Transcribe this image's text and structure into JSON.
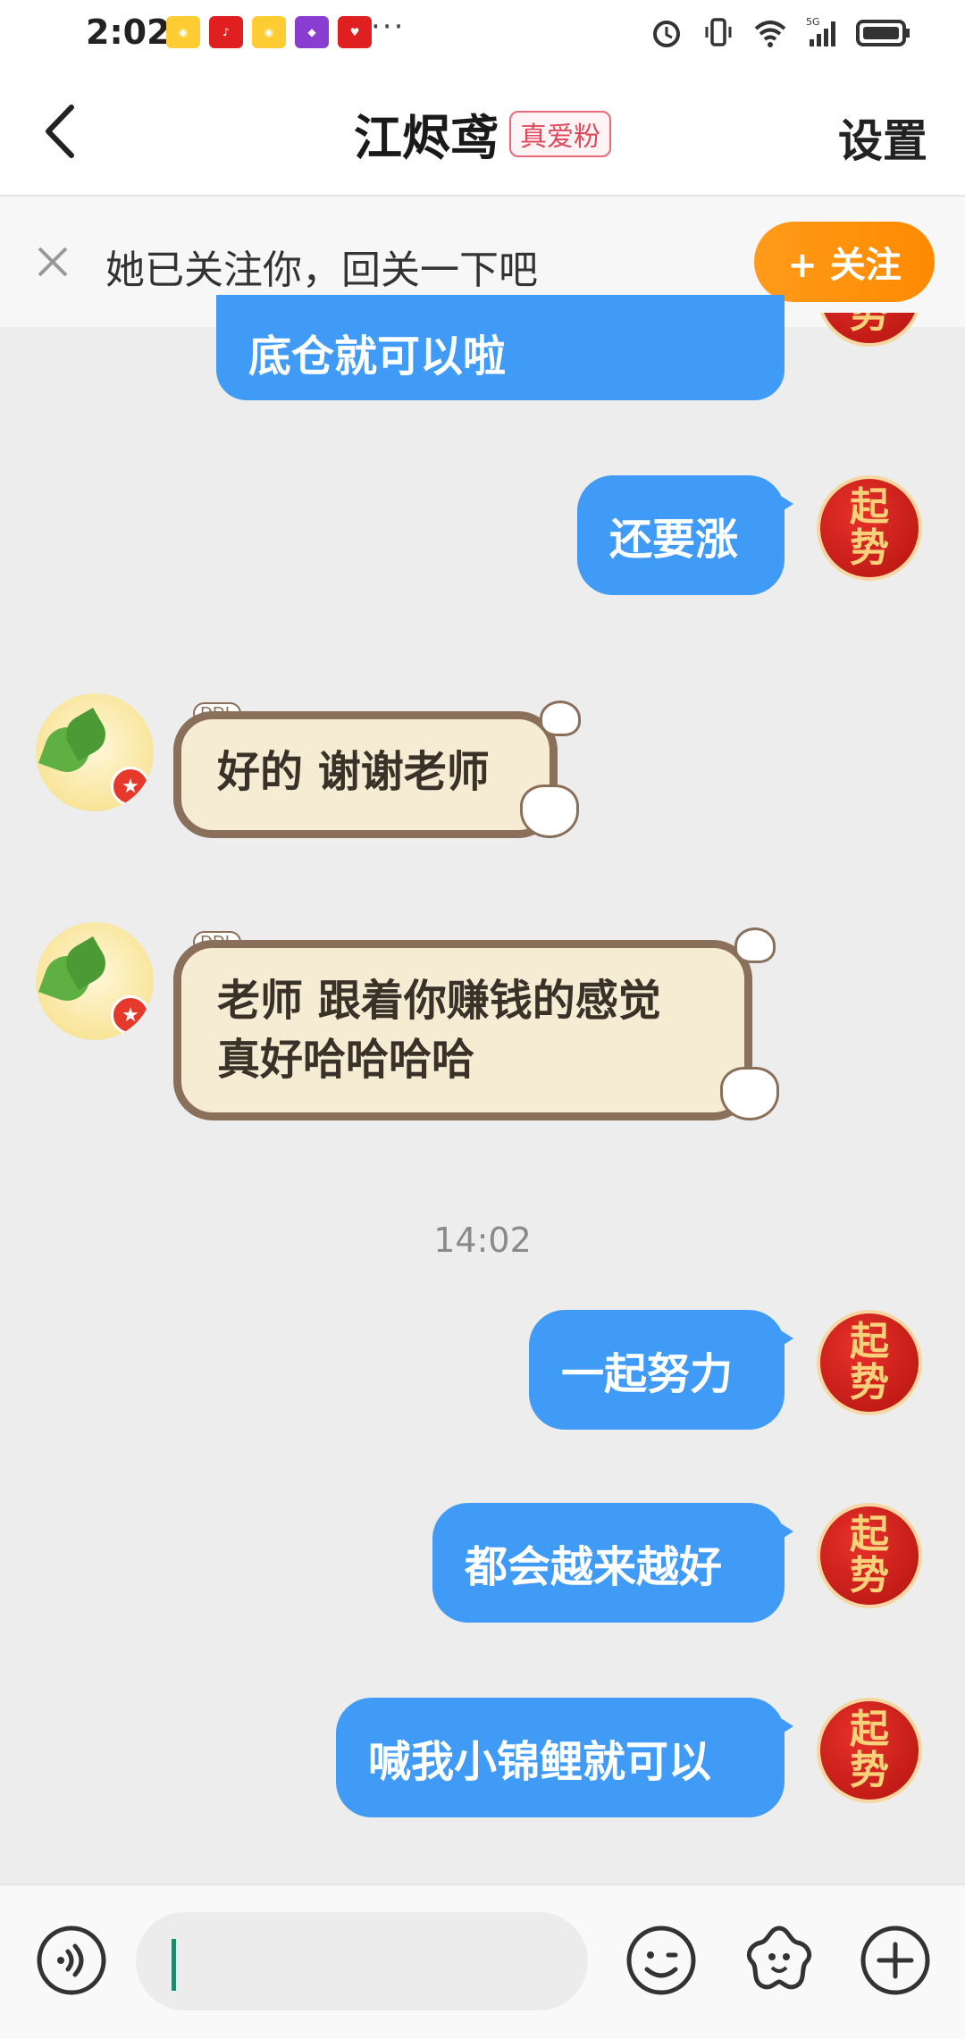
{
  "status_bar": {
    "time": "2:02",
    "dots": "···",
    "net": "5G"
  },
  "header": {
    "title": "江烬鸢",
    "badge": "真爱粉",
    "settings": "设置"
  },
  "follow_banner": {
    "text": "她已关注你，回关一下吧",
    "button": "+ 关注"
  },
  "avatar_me": {
    "line1": "起",
    "line2": "势"
  },
  "messages": {
    "m0": "底仓就可以啦",
    "m1": "还要涨",
    "m2": "好的 谢谢老师",
    "m3_line1": "老师 跟着你赚钱的感觉",
    "m3_line2": "真好哈哈哈哈",
    "time": "14:02",
    "m4": "一起努力",
    "m5": "都会越来越好",
    "m6": "喊我小锦鲤就可以"
  },
  "fancy_tag": "DDL",
  "colors": {
    "outgoing_bubble": "#3f9bf5",
    "follow_button": "#ff8a00",
    "badge": "#e0485c"
  }
}
